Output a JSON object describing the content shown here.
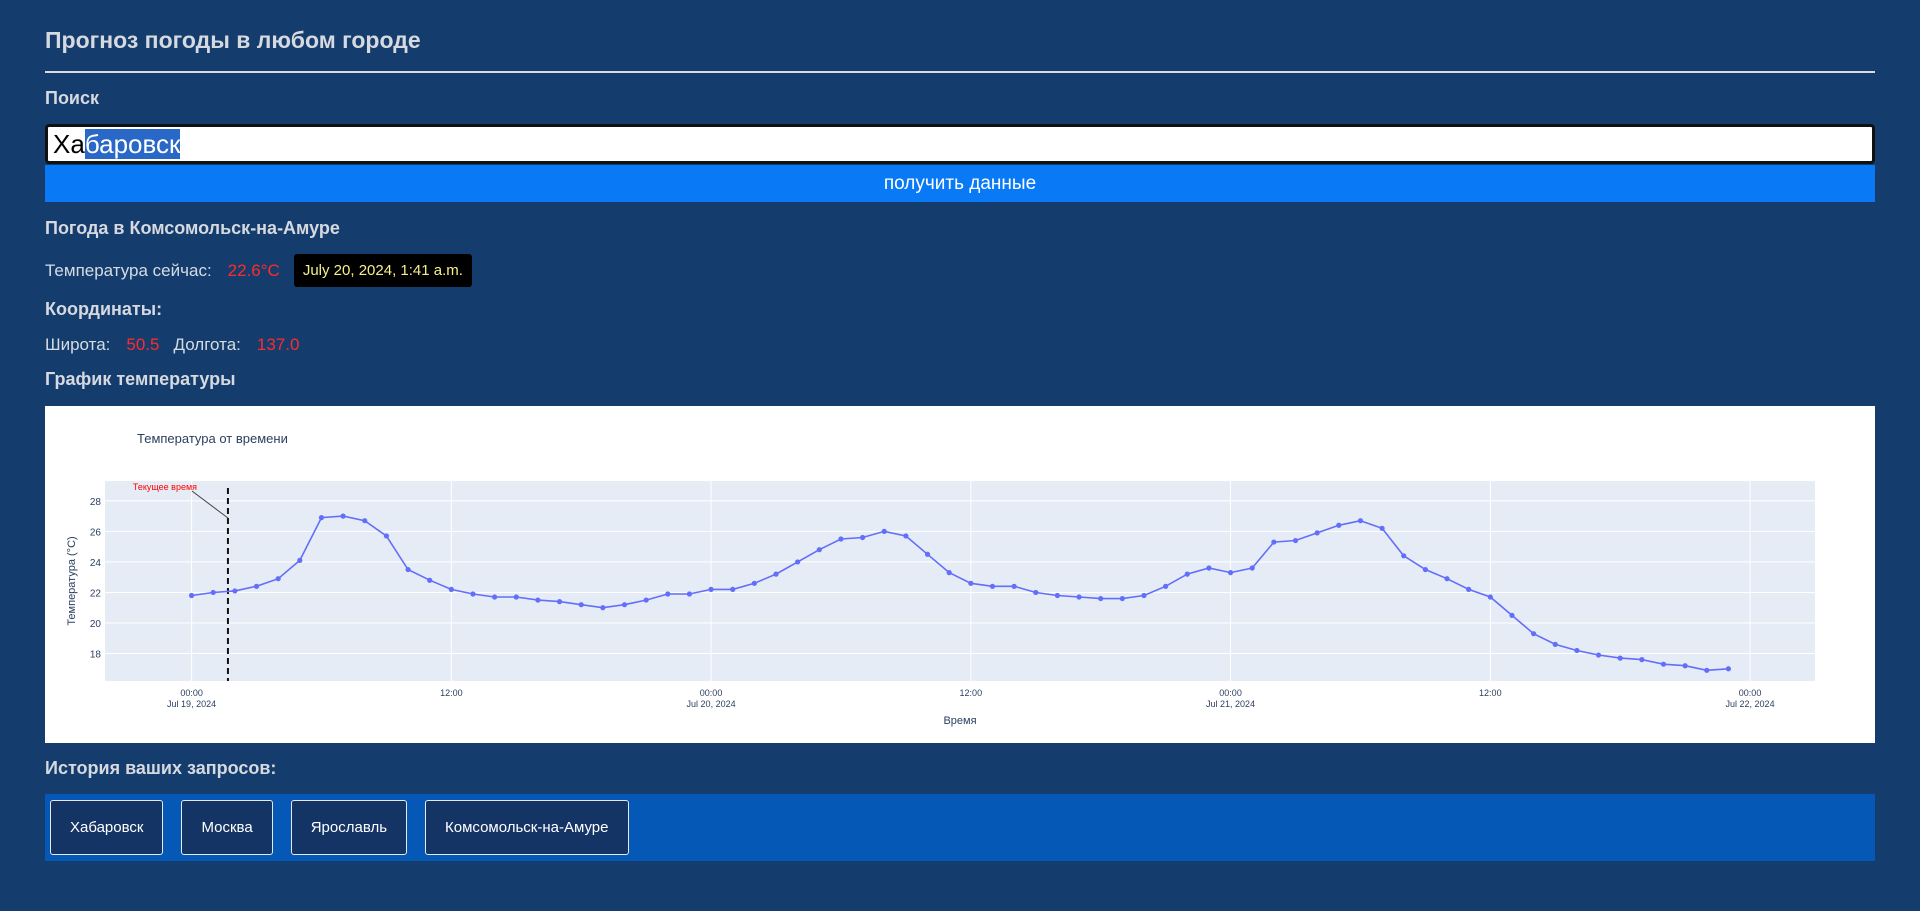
{
  "header": {
    "title": "Прогноз погоды в любом городе"
  },
  "search": {
    "label": "Поиск",
    "value_prefix": "Ха",
    "value_selected": "баровск",
    "button_label": "получить данные"
  },
  "weather": {
    "heading": "Погода в Комсомольск-на-Амуре",
    "temp_label": "Температура сейчас:",
    "temp_value": "22.6°C",
    "datetime": "July 20, 2024, 1:41 a.m."
  },
  "coords": {
    "heading": "Координаты:",
    "lat_label": "Широта:",
    "lat_value": "50.5",
    "lon_label": "Долгота:",
    "lon_value": "137.0"
  },
  "chart_section": {
    "heading": "График температуры"
  },
  "chart_data": {
    "type": "line",
    "title": "Температура от времени",
    "xlabel": "Время",
    "ylabel": "Температура (°C)",
    "ylim": [
      16.2,
      29.3
    ],
    "yticks": [
      18,
      20,
      22,
      24,
      26,
      28
    ],
    "x_start": "2024-07-19 00:00",
    "x_step_hours": 1,
    "xticks": [
      {
        "hour": 0,
        "line1": "00:00",
        "line2": "Jul 19, 2024"
      },
      {
        "hour": 12,
        "line1": "12:00",
        "line2": ""
      },
      {
        "hour": 24,
        "line1": "00:00",
        "line2": "Jul 20, 2024"
      },
      {
        "hour": 36,
        "line1": "12:00",
        "line2": ""
      },
      {
        "hour": 48,
        "line1": "00:00",
        "line2": "Jul 21, 2024"
      },
      {
        "hour": 60,
        "line1": "12:00",
        "line2": ""
      },
      {
        "hour": 72,
        "line1": "00:00",
        "line2": "Jul 22, 2024"
      }
    ],
    "x_range_hours": [
      -4,
      75
    ],
    "current_time": {
      "hour": 1.68,
      "label": "Текущее время"
    },
    "series": [
      {
        "color": "#636efa",
        "values": [
          21.8,
          22.0,
          22.1,
          22.4,
          22.9,
          24.1,
          26.9,
          27.0,
          26.7,
          25.7,
          23.5,
          22.8,
          22.2,
          21.9,
          21.7,
          21.7,
          21.5,
          21.4,
          21.2,
          21.0,
          21.2,
          21.5,
          21.9,
          21.9,
          22.2,
          22.2,
          22.6,
          23.2,
          24.0,
          24.8,
          25.5,
          25.6,
          26.0,
          25.7,
          24.5,
          23.3,
          22.6,
          22.4,
          22.4,
          22.0,
          21.8,
          21.7,
          21.6,
          21.6,
          21.8,
          22.4,
          23.2,
          23.6,
          23.3,
          23.6,
          25.3,
          25.4,
          25.9,
          26.4,
          26.7,
          26.2,
          24.4,
          23.5,
          22.9,
          22.2,
          21.7,
          20.5,
          19.3,
          18.6,
          18.2,
          17.9,
          17.7,
          17.6,
          17.3,
          17.2,
          16.9,
          17.0
        ]
      }
    ]
  },
  "history": {
    "heading": "История ваших запросов:",
    "items": [
      "Хабаровск",
      "Москва",
      "Ярославль",
      "Комсомольск-на-Амуре"
    ]
  }
}
